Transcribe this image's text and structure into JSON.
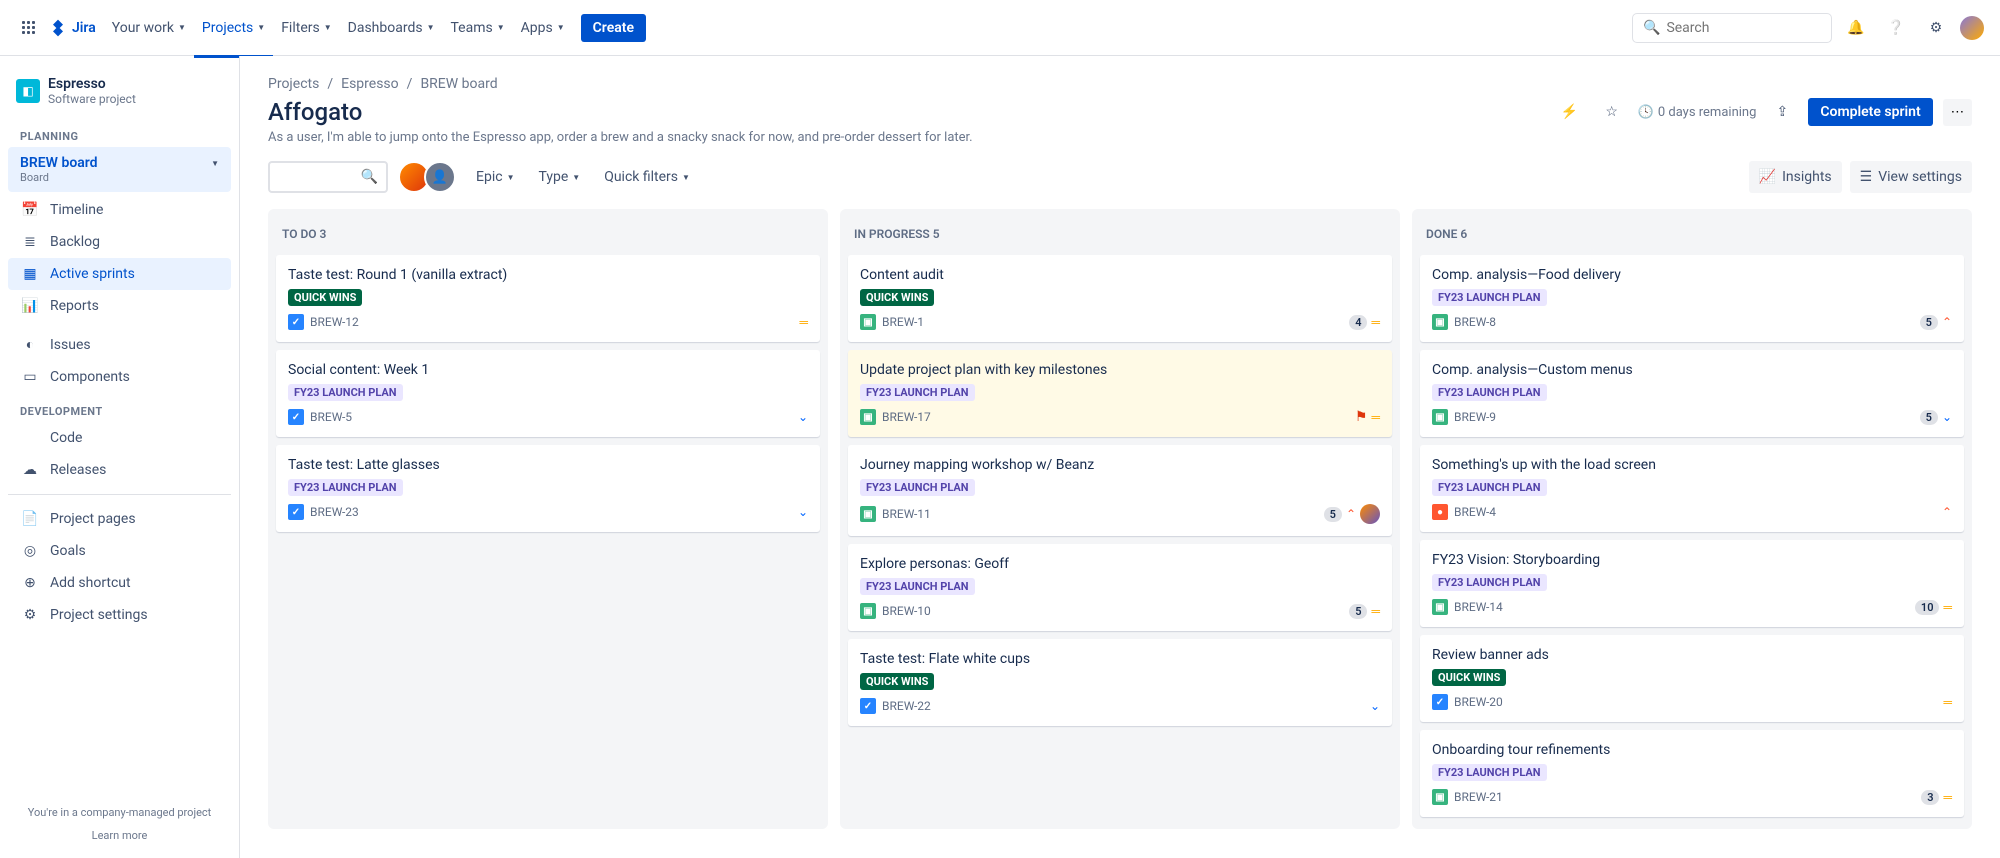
{
  "topnav": {
    "product": "Jira",
    "items": [
      "Your work",
      "Projects",
      "Filters",
      "Dashboards",
      "Teams",
      "Apps"
    ],
    "active_index": 1,
    "create": "Create",
    "search_placeholder": "Search"
  },
  "sidebar": {
    "project_name": "Espresso",
    "project_type": "Software project",
    "planning_label": "PLANNING",
    "board_group": {
      "title": "BREW board",
      "subtitle": "Board"
    },
    "planning_items": [
      {
        "icon": "timeline-icon",
        "label": "Timeline"
      },
      {
        "icon": "backlog-icon",
        "label": "Backlog"
      },
      {
        "icon": "sprints-icon",
        "label": "Active sprints",
        "selected": true
      },
      {
        "icon": "reports-icon",
        "label": "Reports"
      }
    ],
    "other_items": [
      {
        "icon": "issues-icon",
        "label": "Issues"
      },
      {
        "icon": "components-icon",
        "label": "Components"
      }
    ],
    "dev_label": "DEVELOPMENT",
    "dev_items": [
      {
        "icon": "code-icon",
        "label": "Code"
      },
      {
        "icon": "releases-icon",
        "label": "Releases"
      }
    ],
    "bottom_items": [
      {
        "icon": "page-icon",
        "label": "Project pages"
      },
      {
        "icon": "goals-icon",
        "label": "Goals"
      },
      {
        "icon": "shortcut-icon",
        "label": "Add shortcut"
      },
      {
        "icon": "settings-icon",
        "label": "Project settings"
      }
    ],
    "footer": "You're in a company-managed project",
    "learn_more": "Learn more"
  },
  "breadcrumb": [
    "Projects",
    "Espresso",
    "BREW board"
  ],
  "page_title": "Affogato",
  "page_subtitle": "As a user, I'm able to jump onto the Espresso app, order a brew and a snacky snack for now, and pre-order dessert for later.",
  "header_actions": {
    "days_remaining": "0 days remaining",
    "complete_sprint": "Complete sprint"
  },
  "filters": {
    "epic": "Epic",
    "type": "Type",
    "quick": "Quick filters",
    "insights": "Insights",
    "view_settings": "View settings"
  },
  "columns": [
    {
      "name": "TO DO",
      "count": 3,
      "cards": [
        {
          "title": "Taste test: Round 1 (vanilla extract)",
          "label": "QUICK WINS",
          "label_color": "green",
          "type": "task",
          "key": "BREW-12",
          "priority": "med"
        },
        {
          "title": "Social content: Week 1",
          "label": "FY23 LAUNCH PLAN",
          "label_color": "purple",
          "type": "task",
          "key": "BREW-5",
          "priority": "low"
        },
        {
          "title": "Taste test: Latte glasses",
          "label": "FY23 LAUNCH PLAN",
          "label_color": "purple",
          "type": "task",
          "key": "BREW-23",
          "priority": "low"
        }
      ]
    },
    {
      "name": "IN PROGRESS",
      "count": 5,
      "cards": [
        {
          "title": "Content audit",
          "label": "QUICK WINS",
          "label_color": "green",
          "type": "story",
          "key": "BREW-1",
          "points": "4",
          "priority": "med"
        },
        {
          "title": "Update project plan with key milestones",
          "label": "FY23 LAUNCH PLAN",
          "label_color": "purple",
          "type": "story",
          "key": "BREW-17",
          "highlight": true,
          "flag": true,
          "priority": "med"
        },
        {
          "title": "Journey mapping workshop w/ Beanz",
          "label": "FY23 LAUNCH PLAN",
          "label_color": "purple",
          "type": "story",
          "key": "BREW-11",
          "points": "5",
          "priority": "high",
          "assignee": true
        },
        {
          "title": "Explore personas: Geoff",
          "label": "FY23 LAUNCH PLAN",
          "label_color": "purple",
          "type": "story",
          "key": "BREW-10",
          "points": "5",
          "priority": "med"
        },
        {
          "title": "Taste test: Flate white cups",
          "label": "QUICK WINS",
          "label_color": "green",
          "type": "task",
          "key": "BREW-22",
          "priority": "low"
        }
      ]
    },
    {
      "name": "DONE",
      "count": 6,
      "cards": [
        {
          "title": "Comp. analysis—Food delivery",
          "label": "FY23 LAUNCH PLAN",
          "label_color": "purple",
          "type": "story",
          "key": "BREW-8",
          "points": "5",
          "priority": "high"
        },
        {
          "title": "Comp. analysis—Custom menus",
          "label": "FY23 LAUNCH PLAN",
          "label_color": "purple",
          "type": "story",
          "key": "BREW-9",
          "points": "5",
          "priority": "low"
        },
        {
          "title": "Something's up with the load screen",
          "label": "FY23 LAUNCH PLAN",
          "label_color": "purple",
          "type": "bug",
          "key": "BREW-4",
          "priority": "high"
        },
        {
          "title": "FY23 Vision: Storyboarding",
          "label": "FY23 LAUNCH PLAN",
          "label_color": "purple",
          "type": "story",
          "key": "BREW-14",
          "points": "10",
          "priority": "med"
        },
        {
          "title": "Review banner ads",
          "label": "QUICK WINS",
          "label_color": "green",
          "type": "task",
          "key": "BREW-20",
          "priority": "med"
        },
        {
          "title": "Onboarding tour refinements",
          "label": "FY23 LAUNCH PLAN",
          "label_color": "purple",
          "type": "story",
          "key": "BREW-21",
          "points": "3",
          "priority": "med"
        }
      ]
    }
  ]
}
